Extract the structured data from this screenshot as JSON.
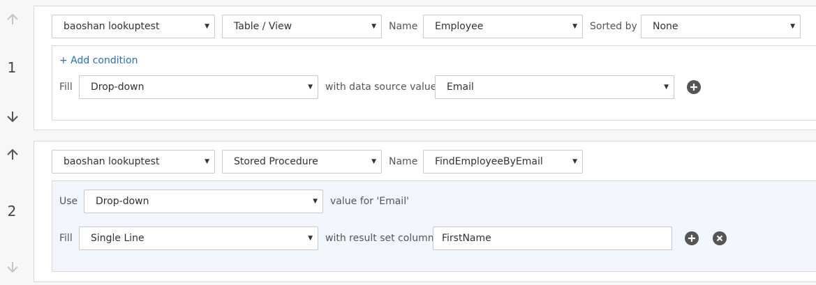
{
  "rules": [
    {
      "number": "1",
      "data_source": "baoshan lookuptest",
      "object_type": "Table / View",
      "name_label": "Name",
      "name_value": "Employee",
      "sorted_label": "Sorted by",
      "sorted_value": "None",
      "add_condition": "+ Add condition",
      "fill_label": "Fill",
      "fill_control": "Drop-down",
      "with_label": "with data source value",
      "source_value": "Email"
    },
    {
      "number": "2",
      "data_source": "baoshan lookuptest",
      "object_type": "Stored Procedure",
      "name_label": "Name",
      "name_value": "FindEmployeeByEmail",
      "use_label": "Use",
      "use_control": "Drop-down",
      "value_for_label": "value for 'Email'",
      "fill_label": "Fill",
      "fill_control": "Single Line",
      "with_label": "with result set column",
      "column_value": "FirstName"
    }
  ],
  "icons": {
    "move_up": "arrow-up-icon",
    "move_down": "arrow-down-icon",
    "add": "plus-circle-icon",
    "remove": "x-circle-icon",
    "dropdown": "caret-down-icon"
  },
  "colors": {
    "link": "#2a6ebb",
    "parameter_panel": "#f1f7fc",
    "icon_circle": "#555555"
  }
}
